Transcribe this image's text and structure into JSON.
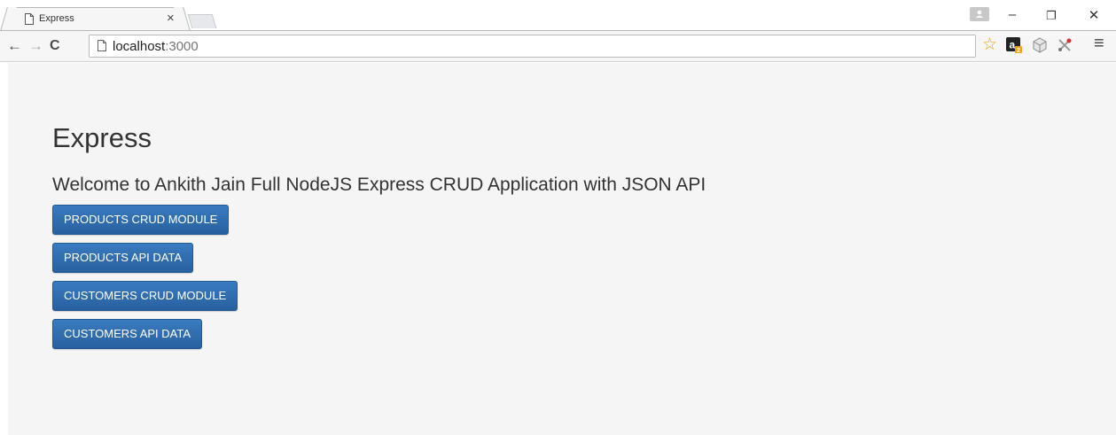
{
  "browser": {
    "tab": {
      "title": "Express",
      "close": "×"
    },
    "window_controls": {
      "minimize": "–",
      "restore": "❐",
      "close": "✕"
    },
    "toolbar": {
      "back": "←",
      "forward": "→",
      "reload": "C",
      "url_host": "localhost",
      "url_port": ":3000",
      "star": "☆",
      "menu": "≡"
    }
  },
  "page": {
    "title": "Express",
    "welcome": "Welcome to Ankith Jain Full NodeJS Express CRUD Application with JSON API",
    "buttons": [
      {
        "label": "PRODUCTS CRUD MODULE"
      },
      {
        "label": "PRODUCTS API DATA"
      },
      {
        "label": "CUSTOMERS CRUD MODULE"
      },
      {
        "label": "CUSTOMERS API DATA"
      }
    ]
  },
  "colors": {
    "button_bg": "#2f6aa8",
    "page_bg": "#f5f5f5"
  }
}
